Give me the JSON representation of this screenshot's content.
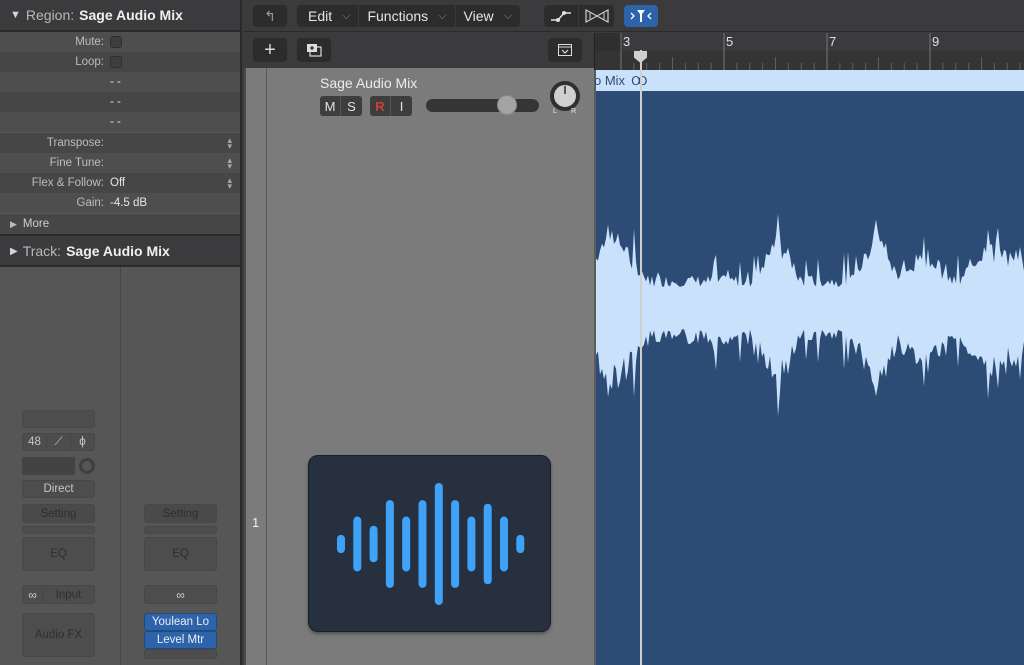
{
  "inspector": {
    "region": {
      "label": "Region:",
      "name": "Sage Audio Mix",
      "rows": [
        {
          "label": "Mute:",
          "type": "checkbox",
          "checked": false
        },
        {
          "label": "Loop:",
          "type": "checkbox",
          "checked": false
        },
        {
          "label": "",
          "value": "- -"
        },
        {
          "label": "",
          "value": "- -"
        },
        {
          "label": "",
          "value": "- -"
        },
        {
          "label": "Transpose:",
          "value": "",
          "stepper": true
        },
        {
          "label": "Fine Tune:",
          "value": "",
          "stepper": true
        },
        {
          "label": "Flex & Follow:",
          "value": "Off",
          "stepper": true
        },
        {
          "label": "Gain:",
          "value": "-4.5 dB"
        }
      ],
      "more_label": "More"
    },
    "track": {
      "label": "Track:",
      "name": "Sage Audio Mix"
    },
    "strip_left": {
      "sample_rate": "48",
      "hpf_symbol": "⟋",
      "phase_symbol": "ϕ",
      "direct": "Direct",
      "setting": "Setting",
      "eq": "EQ",
      "input_label": "Input",
      "link_symbol": "∞",
      "audio_fx": "Audio FX"
    },
    "strip_right": {
      "setting": "Setting",
      "eq": "EQ",
      "link_symbol": "∞",
      "plugins": [
        "Youlean Lo",
        "Level Mtr"
      ]
    }
  },
  "toolbar": {
    "back_icon": "↰",
    "menus": [
      {
        "label": "Edit"
      },
      {
        "label": "Functions"
      },
      {
        "label": "View"
      }
    ],
    "catch_active": true,
    "accent": "#2d63a8"
  },
  "track_header": {
    "add_label": "+",
    "track_name": "Sage Audio Mix",
    "mute": "M",
    "solo": "S",
    "record": "R",
    "input": "I",
    "volume_fraction": 0.72,
    "pan_labels": [
      "L",
      "R"
    ],
    "track_number": "1"
  },
  "ruler": {
    "bars": [
      "3",
      "5",
      "7",
      "9"
    ]
  },
  "region": {
    "visible_name": "o Mix",
    "fill_color": "#c9e1fb",
    "bg_color": "#2c4c76"
  },
  "plugin_window": {
    "bar_color": "#3fa2f7",
    "bars": [
      0.15,
      0.45,
      0.3,
      0.72,
      0.45,
      0.72,
      1.0,
      0.72,
      0.45,
      0.66,
      0.45,
      0.15
    ]
  }
}
